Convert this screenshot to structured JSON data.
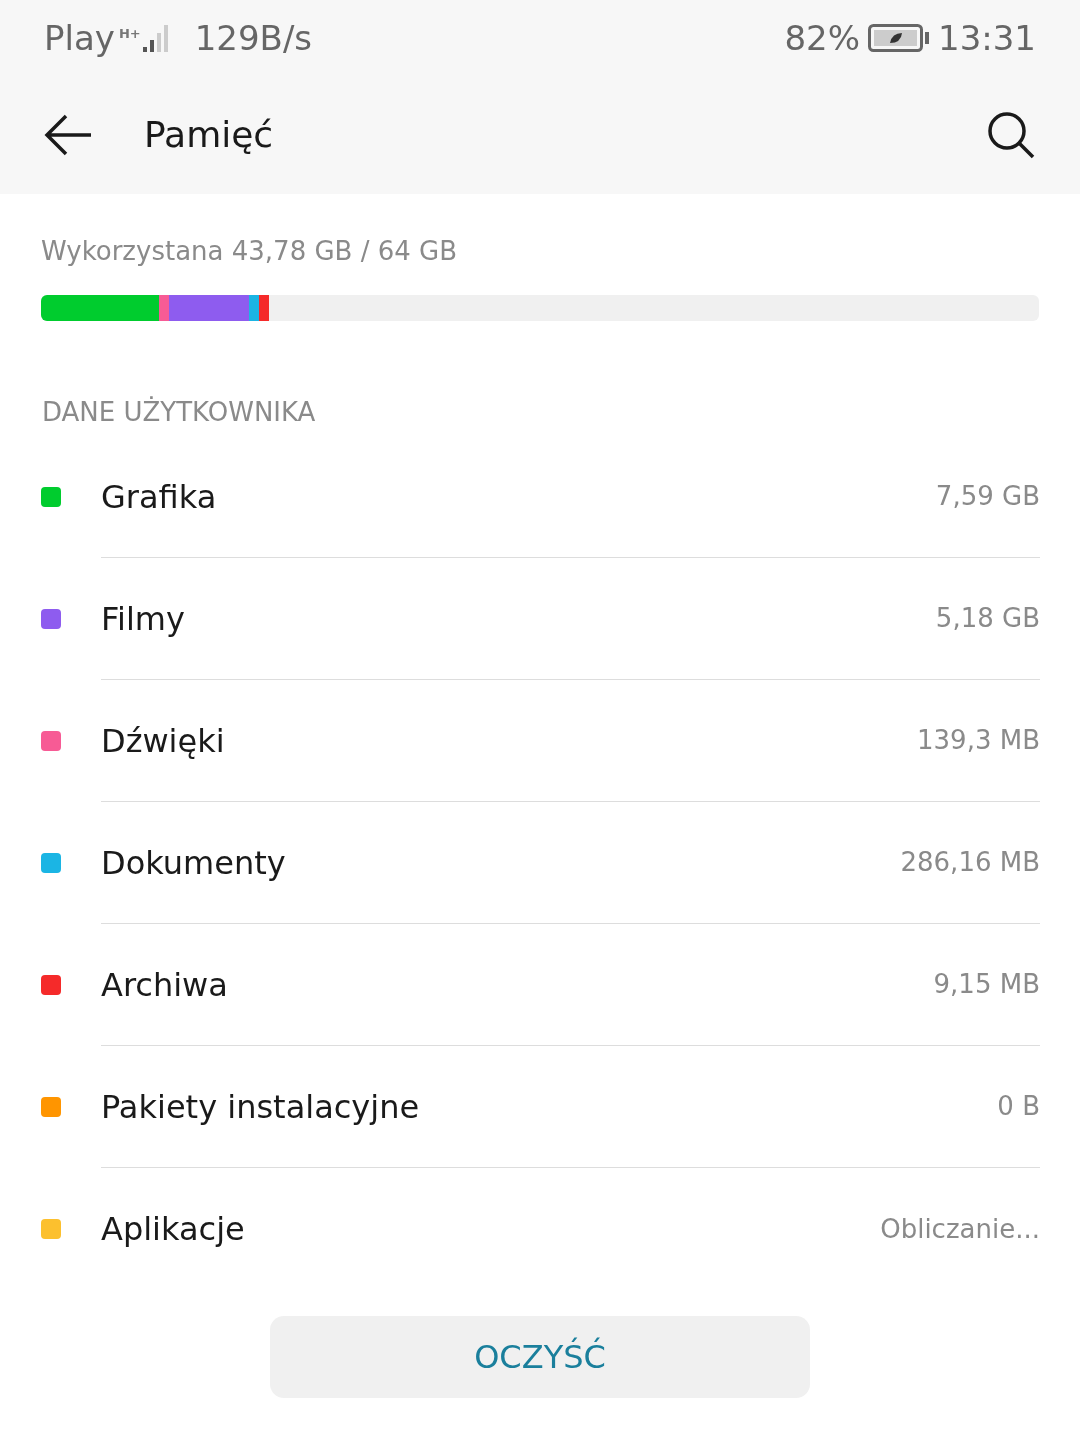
{
  "status_bar": {
    "carrier": "Play",
    "network_type": "H+",
    "speed": "129B/s",
    "battery": "82%",
    "time": "13:31"
  },
  "header": {
    "title": "Pamięć"
  },
  "usage": {
    "label": "Wykorzystana 43,78 GB / 64 GB",
    "segments": [
      {
        "color": "#00cc2e",
        "level": 0.118
      },
      {
        "color": "#f75b95"
      },
      {
        "color": "#8e5cef"
      },
      {
        "color": "#1bb5e4"
      },
      {
        "color": "#f52a2a"
      }
    ]
  },
  "section": {
    "title": "DANE UŻYTKOWNIKA"
  },
  "categories": [
    {
      "name": "Grafika",
      "size": "7,59 GB",
      "color": "#00cc2e"
    },
    {
      "name": "Filmy",
      "size": "5,18 GB",
      "color": "#8e5cef"
    },
    {
      "name": "Dźwięki",
      "size": "139,3 MB",
      "color": "#f75b95"
    },
    {
      "name": "Dokumenty",
      "size": "286,16 MB",
      "color": "#1bb5e4"
    },
    {
      "name": "Archiwa",
      "size": "9,15 MB",
      "color": "#f52a2a"
    },
    {
      "name": "Pakiety instalacyjne",
      "size": "0 B",
      "color": "#ff9500"
    },
    {
      "name": "Aplikacje",
      "size": "Obliczanie...",
      "color": "#fcc02e"
    }
  ],
  "button": {
    "label": "OCZYŚĆ"
  }
}
